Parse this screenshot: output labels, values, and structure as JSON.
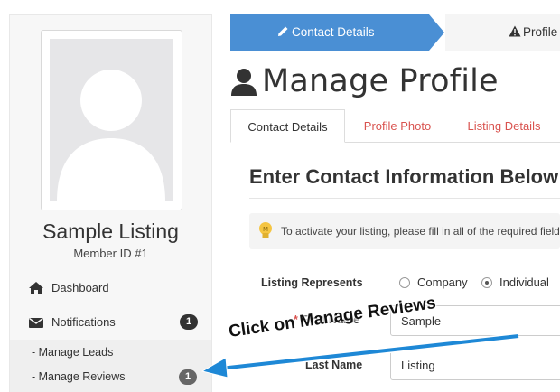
{
  "sidebar": {
    "listing_name": "Sample Listing",
    "member_id": "Member ID #1",
    "nav": [
      {
        "label": "Dashboard",
        "icon": "home-icon"
      },
      {
        "label": "Notifications",
        "icon": "envelope-icon",
        "badge": "1"
      }
    ],
    "submenu": [
      {
        "label": "- Manage Leads"
      },
      {
        "label": "- Manage Reviews",
        "badge": "1"
      }
    ]
  },
  "wizard": {
    "steps": [
      {
        "label": "Contact Details",
        "icon": "pencil-icon",
        "active": true
      },
      {
        "label": "Profile",
        "icon": "warning-icon",
        "active": false
      }
    ],
    "active_color": "#4a8fd4"
  },
  "page": {
    "title": "Manage Profile",
    "title_icon": "user-icon"
  },
  "tabs": [
    {
      "label": "Contact Details",
      "active": true
    },
    {
      "label": "Profile Photo",
      "active": false
    },
    {
      "label": "Listing Details",
      "active": false
    }
  ],
  "form": {
    "heading": "Enter Contact Information Below",
    "info_text": "To activate your listing, please fill in all of the required fields",
    "info_icon": "lightbulb-icon",
    "listing_represents": {
      "label": "Listing Represents",
      "options": [
        "Company",
        "Individual"
      ],
      "selected": "Individual"
    },
    "first_name": {
      "required_mark": "*",
      "label": "First Name",
      "value": "Sample"
    },
    "last_name": {
      "label": "Last Name",
      "value": "Listing"
    }
  },
  "annotation": {
    "text": "Click on Manage Reviews",
    "arrow_color": "#1e88d6"
  },
  "colors": {
    "link_red": "#d9534f",
    "badge_bg": "#333333"
  }
}
